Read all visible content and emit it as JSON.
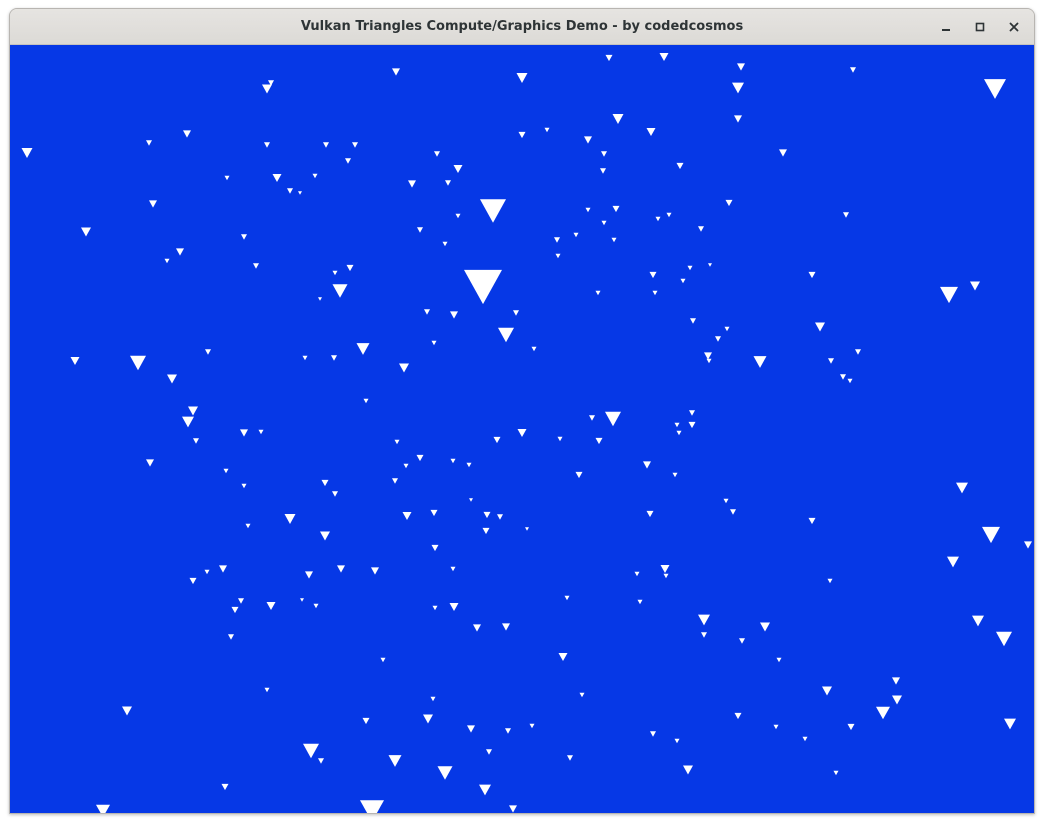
{
  "window": {
    "title": "Vulkan Triangles Compute/Graphics Demo - by codedcosmos"
  },
  "controls": [
    {
      "name": "minimize-button",
      "icon": "minimize-icon"
    },
    {
      "name": "maximize-button",
      "icon": "maximize-icon"
    },
    {
      "name": "close-button",
      "icon": "close-icon"
    }
  ],
  "canvas": {
    "background_color": "#0638e6",
    "particle_color": "#ffffff"
  }
}
